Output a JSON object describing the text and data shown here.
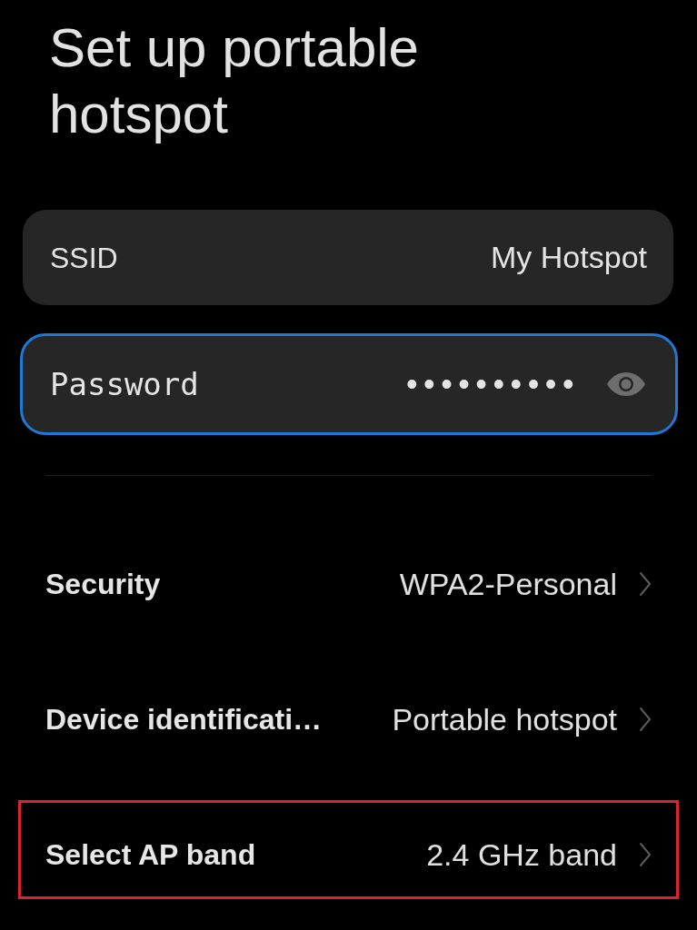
{
  "title": "Set up portable hotspot",
  "ssid": {
    "label": "SSID",
    "value": "My Hotspot"
  },
  "password": {
    "label": "Password",
    "value": "••••••••••",
    "focused": true
  },
  "settings": [
    {
      "label": "Security",
      "value": "WPA2-Personal",
      "highlighted": false
    },
    {
      "label": "Device identificati…",
      "value": "Portable hotspot",
      "highlighted": false
    },
    {
      "label": "Select AP band",
      "value": "2.4 GHz band",
      "highlighted": true
    }
  ]
}
